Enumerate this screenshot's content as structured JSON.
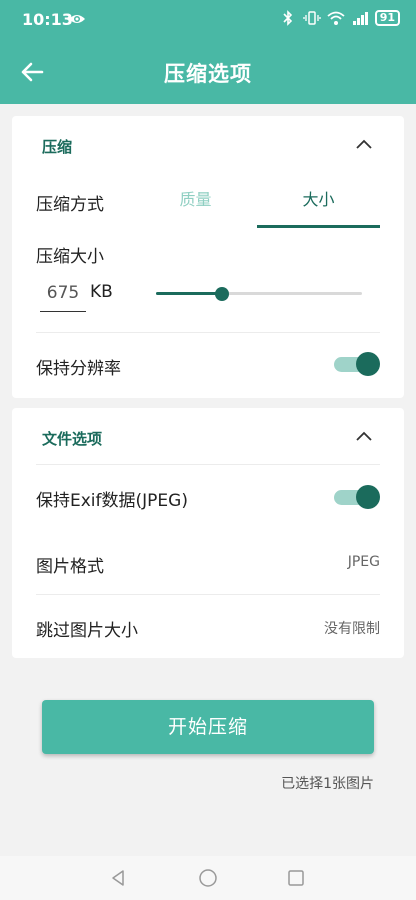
{
  "status_bar": {
    "time": "10:13",
    "battery": "91"
  },
  "header": {
    "title": "压缩选项"
  },
  "compress_section": {
    "title": "压缩",
    "method_label": "压缩方式",
    "tabs": [
      "质量",
      "大小"
    ],
    "active_tab": "大小",
    "size_label": "压缩大小",
    "size_value": "675",
    "size_unit": "KB",
    "slider_fraction": 0.32,
    "keep_resolution_label": "保持分辨率",
    "keep_resolution_on": true
  },
  "file_section": {
    "title": "文件选项",
    "exif_label": "保持Exif数据(JPEG)",
    "exif_on": true,
    "format_label": "图片格式",
    "format_value": "JPEG",
    "skip_label": "跳过图片大小",
    "skip_value": "没有限制"
  },
  "actions": {
    "start_label": "开始压缩",
    "selected_info": "已选择1张图片"
  },
  "colors": {
    "accent": "#49b8a5",
    "dark_accent": "#1b6b5c",
    "background": "#f2f2f2"
  }
}
